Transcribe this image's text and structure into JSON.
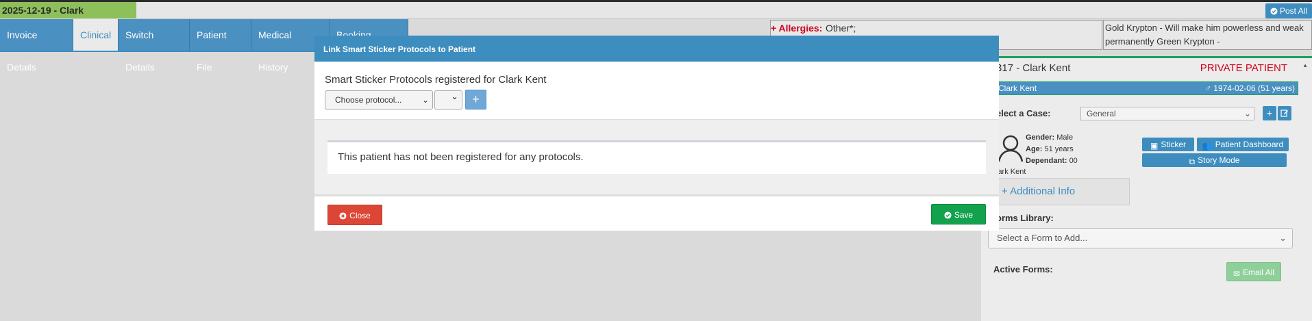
{
  "topbar": {
    "title": "2025-12-19 - Clark",
    "post_all": "Post All"
  },
  "tabs": [
    {
      "label": "Invoice Details",
      "active": false
    },
    {
      "label": "Clinical",
      "active": true
    },
    {
      "label": "Switch Details",
      "active": false
    },
    {
      "label": "Patient File",
      "active": false
    },
    {
      "label": "Medical History",
      "active": false
    },
    {
      "label": "Booking History",
      "active": false
    }
  ],
  "alerts": {
    "allergy_label": "+ Allergies:",
    "allergy_value": "Other*;",
    "notes": "Gold Krypton - Will make him powerless and weak permanently Green Krypton -"
  },
  "patient_panel": {
    "title": "317 - Clark Kent",
    "type": "PRIVATE PATIENT",
    "bar_name": "Clark Kent",
    "bar_dob": "1974-02-06 (51 years)",
    "case_label": "elect a Case:",
    "case_value": "General",
    "gender_label": "Gender:",
    "gender_value": "Male",
    "age_label": "Age:",
    "age_value": "51 years",
    "dependant_label": "Dependant:",
    "dependant_value": "00",
    "name": "lark Kent",
    "sticker_btn": "Sticker",
    "dashboard_btn": "Patient Dashboard",
    "story_btn": "Story Mode",
    "additional_info": "+ Additional Info",
    "forms_label": "orms Library:",
    "forms_placeholder": "Select a Form to Add...",
    "active_forms_label": "Active Forms:",
    "email_all": "Email All"
  },
  "modal": {
    "title": "Link Smart Sticker Protocols to Patient",
    "heading": "Smart Sticker Protocols registered for Clark Kent",
    "protocol_select": "Choose protocol...",
    "plus": "+",
    "empty_message": "This patient has not been registered for any protocols.",
    "close": "Close",
    "save": "Save"
  },
  "colors": {
    "primary": "#3e8dbf",
    "danger": "#dc4636",
    "success": "#12a24d",
    "accent_green": "#8dbf5a",
    "allergy_red": "#d0021b"
  }
}
